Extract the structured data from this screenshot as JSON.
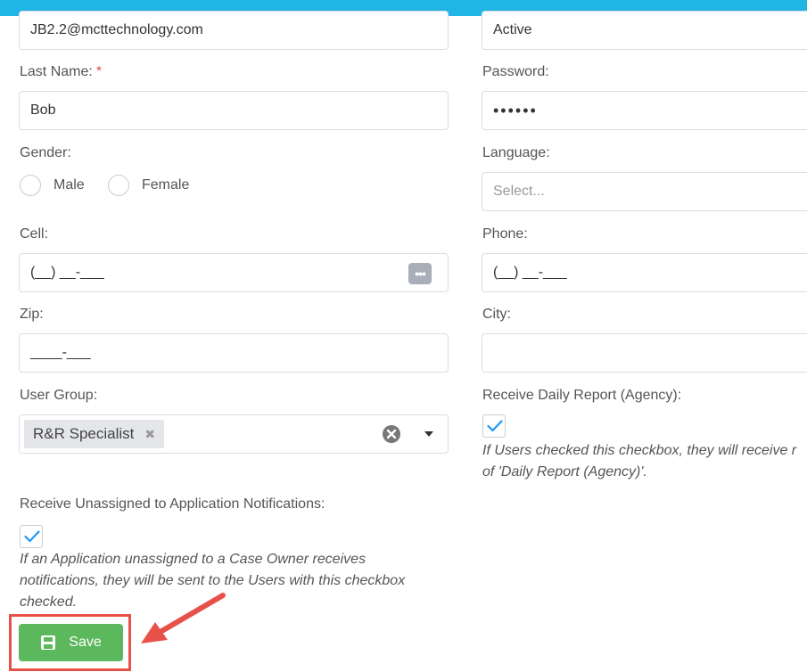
{
  "colors": {
    "header": "#21b5e6",
    "save": "#5cb85c",
    "annotation": "#e8514a",
    "check": "#2196f3"
  },
  "form": {
    "email_value": "JB2.2@mcttechnology.com",
    "status_value": "Active",
    "last_name": {
      "label": "Last Name:",
      "required_mark": "*",
      "value": "Bob"
    },
    "password": {
      "label": "Password:",
      "value": "••••••"
    },
    "gender": {
      "label": "Gender:",
      "options": [
        "Male",
        "Female"
      ]
    },
    "language": {
      "label": "Language:",
      "placeholder": "Select..."
    },
    "cell": {
      "label": "Cell:",
      "value": "(__) __-___",
      "icon": "ellipsis-icon"
    },
    "phone": {
      "label": "Phone:",
      "value": "(__) __-___"
    },
    "zip": {
      "label": "Zip:",
      "value": "____-___"
    },
    "city": {
      "label": "City:",
      "value": ""
    },
    "user_group": {
      "label": "User Group:",
      "tags": [
        "R&R Specialist"
      ]
    },
    "daily_report": {
      "label": "Receive Daily Report (Agency):",
      "checked": true,
      "note_line1": "If Users checked this checkbox, they will receive r",
      "note_line2": "of 'Daily Report (Agency)'."
    },
    "unassigned": {
      "label": "Receive Unassigned to Application Notifications:",
      "checked": true,
      "note_line1": "If an Application unassigned to a Case Owner receives",
      "note_line2": "notifications, they will be sent to the Users with this checkbox",
      "note_line3": "checked."
    }
  },
  "actions": {
    "save_label": "Save"
  }
}
